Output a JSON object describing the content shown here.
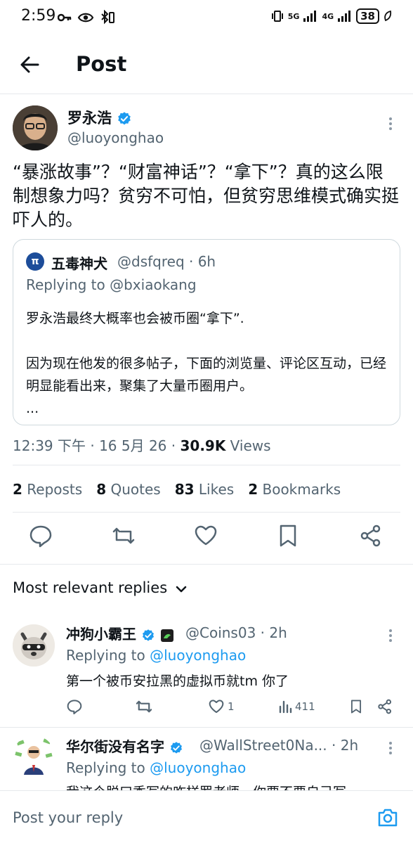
{
  "status_bar": {
    "time": "2:59",
    "network_label": "5G",
    "network_label_2": "4G",
    "battery": "38"
  },
  "header": {
    "title": "Post"
  },
  "post": {
    "author_name": "罗永浩",
    "author_handle": "@luoyonghao",
    "text": "“暴涨故事”？“财富神话”？“拿下”？真的这么限制想象力吗？贫穷不可怕，但贫穷思维模式确实挺吓人的。",
    "quote": {
      "avatar_glyph": "π",
      "author_name": "五毒神犬",
      "author_handle": "@dsfqreq · 6h",
      "replying_to": "Replying to @bxiaokang",
      "text_line1": "罗永浩最终大概率也会被币圈“拿下”.",
      "text_line2": "因为现在他发的很多帖子，下面的浏览量、评论区互动，已经明显能看出来，聚集了大量币圈用户。",
      "text_line3": "..."
    },
    "meta_time": "12:39 下午 · 16 5月 26 · ",
    "meta_views_count": "30.9K",
    "meta_views_label": " Views",
    "stats": {
      "reposts_count": "2",
      "reposts_label": " Reposts",
      "quotes_count": "8",
      "quotes_label": " Quotes",
      "likes_count": "83",
      "likes_label": " Likes",
      "bookmarks_count": "2",
      "bookmarks_label": " Bookmarks"
    }
  },
  "replies_section": {
    "title": "Most relevant replies"
  },
  "replies": [
    {
      "name": "冲狗小霸王",
      "handle": "@Coins03 · 2h",
      "replying_prefix": "Replying to ",
      "replying_handle": "@luoyonghao",
      "text": "第一个被币安拉黑的虚拟币就tm 你了",
      "likes": "1",
      "views": "411"
    },
    {
      "name": "华尔街没有名字",
      "handle": "@WallStreet0Na... · 2h",
      "replying_prefix": "Replying to ",
      "replying_handle": "@luoyonghao",
      "text": "我这个脱口秀写的咋样罗老师，你要不要自己写"
    }
  ],
  "composer": {
    "placeholder": "Post your reply"
  },
  "colors": {
    "accent": "#1d9bf0",
    "secondary_text": "#536471",
    "primary_text": "#0f1419"
  }
}
